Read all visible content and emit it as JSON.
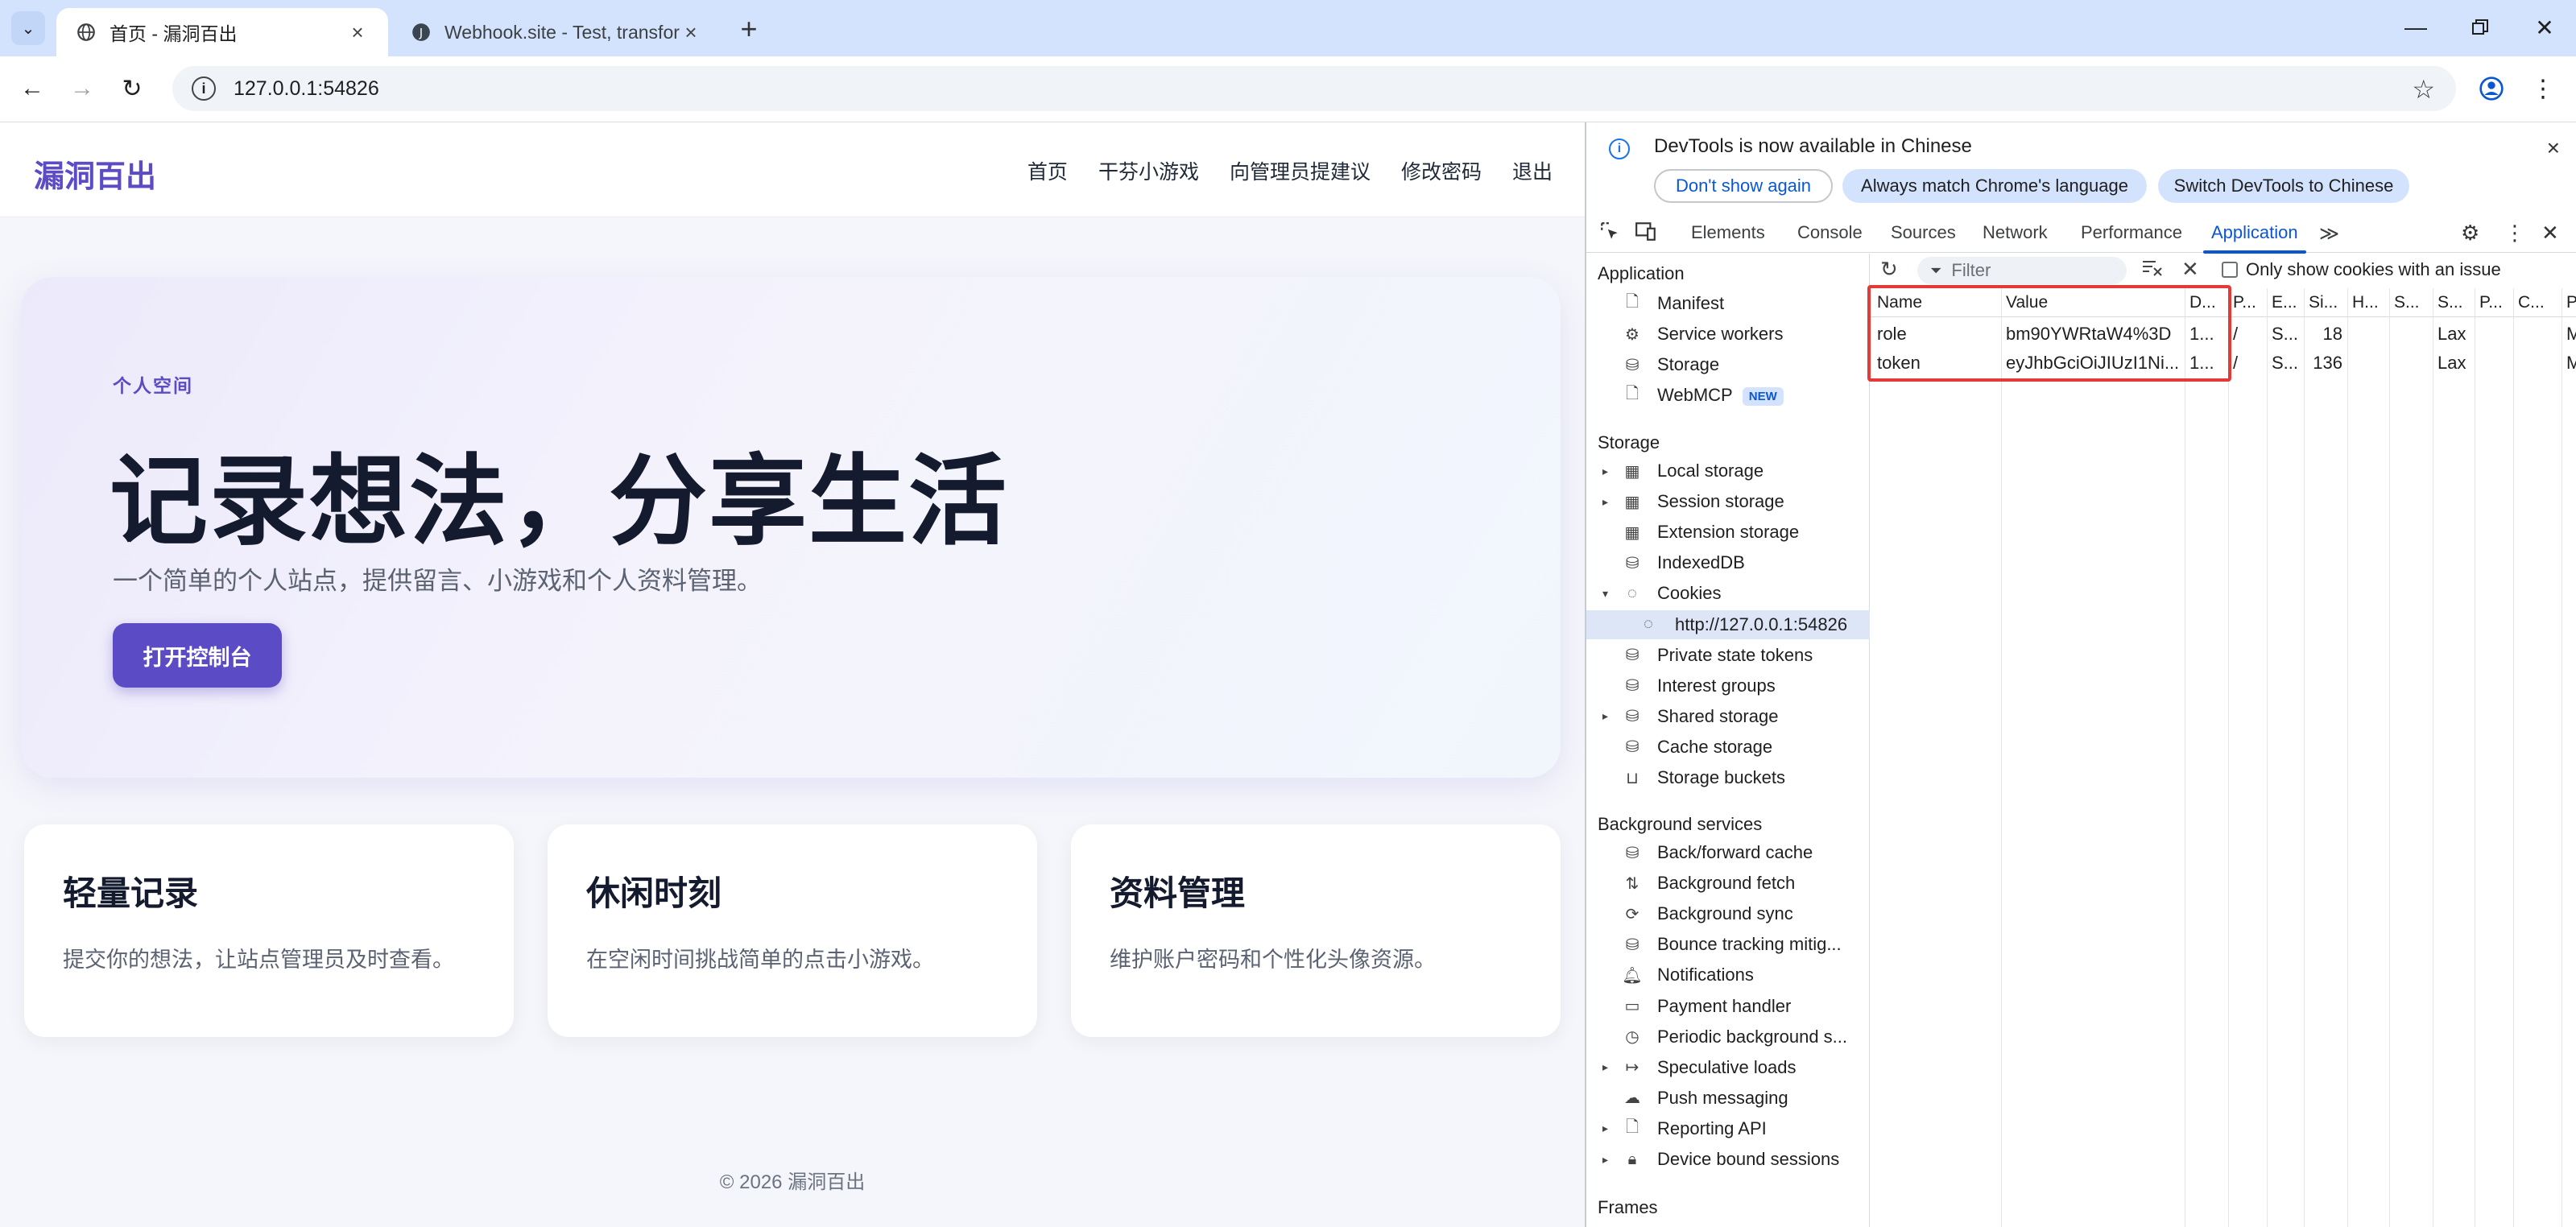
{
  "browser": {
    "tabs": [
      {
        "title": "首页 - 漏洞百出",
        "active": true
      },
      {
        "title": "Webhook.site - Test, transfor",
        "active": false
      }
    ],
    "url": "127.0.0.1:54826"
  },
  "site": {
    "logo": "漏洞百出",
    "nav": [
      "首页",
      "干芬小游戏",
      "向管理员提建议",
      "修改密码",
      "退出"
    ],
    "hero": {
      "eyebrow": "个人空间",
      "title": "记录想法，分享生活",
      "subtitle": "一个简单的个人站点，提供留言、小游戏和个人资料管理。",
      "cta": "打开控制台"
    },
    "cards": [
      {
        "title": "轻量记录",
        "desc": "提交你的想法，让站点管理员及时查看。"
      },
      {
        "title": "休闲时刻",
        "desc": "在空闲时间挑战简单的点击小游戏。"
      },
      {
        "title": "资料管理",
        "desc": "维护账户密码和个性化头像资源。"
      }
    ],
    "footer": "© 2026 漏洞百出"
  },
  "devtools": {
    "infobar": {
      "message": "DevTools is now available in Chinese",
      "buttons": [
        "Don't show again",
        "Always match Chrome's language",
        "Switch DevTools to Chinese"
      ]
    },
    "tabs": [
      "Elements",
      "Console",
      "Sources",
      "Network",
      "Performance",
      "Application"
    ],
    "active_tab": "Application",
    "filter_placeholder": "Filter",
    "only_issue_label": "Only show cookies with an issue",
    "sections": {
      "application": "Application",
      "storage": "Storage",
      "background": "Background services",
      "frames": "Frames"
    },
    "application_items": [
      {
        "label": "Manifest",
        "icon": "file-icon"
      },
      {
        "label": "Service workers",
        "icon": "gears-icon"
      },
      {
        "label": "Storage",
        "icon": "database-icon"
      },
      {
        "label": "WebMCP",
        "icon": "file-icon",
        "badge": "NEW"
      }
    ],
    "storage_items": [
      {
        "label": "Local storage",
        "icon": "table-icon",
        "arrow": "▸"
      },
      {
        "label": "Session storage",
        "icon": "table-icon",
        "arrow": "▸"
      },
      {
        "label": "Extension storage",
        "icon": "table-icon",
        "arrow": ""
      },
      {
        "label": "IndexedDB",
        "icon": "database-icon",
        "arrow": ""
      },
      {
        "label": "Cookies",
        "icon": "cookie-icon",
        "arrow": "▾"
      },
      {
        "label": "http://127.0.0.1:54826",
        "icon": "cookie-icon",
        "arrow": "",
        "child": true,
        "selected": true
      },
      {
        "label": "Private state tokens",
        "icon": "database-icon",
        "arrow": ""
      },
      {
        "label": "Interest groups",
        "icon": "database-icon",
        "arrow": ""
      },
      {
        "label": "Shared storage",
        "icon": "database-icon",
        "arrow": "▸"
      },
      {
        "label": "Cache storage",
        "icon": "database-icon",
        "arrow": ""
      },
      {
        "label": "Storage buckets",
        "icon": "bucket-icon",
        "arrow": ""
      }
    ],
    "background_items": [
      {
        "label": "Back/forward cache",
        "icon": "database-icon",
        "arrow": ""
      },
      {
        "label": "Background fetch",
        "icon": "updown-icon",
        "arrow": ""
      },
      {
        "label": "Background sync",
        "icon": "sync-icon",
        "arrow": ""
      },
      {
        "label": "Bounce tracking mitig...",
        "icon": "database-icon",
        "arrow": ""
      },
      {
        "label": "Notifications",
        "icon": "bell-icon",
        "arrow": ""
      },
      {
        "label": "Payment handler",
        "icon": "card-icon",
        "arrow": ""
      },
      {
        "label": "Periodic background s...",
        "icon": "clock-icon",
        "arrow": ""
      },
      {
        "label": "Speculative loads",
        "icon": "arrow-right-icon",
        "arrow": "▸"
      },
      {
        "label": "Push messaging",
        "icon": "cloud-icon",
        "arrow": ""
      },
      {
        "label": "Reporting API",
        "icon": "file-icon",
        "arrow": "▸"
      },
      {
        "label": "Device bound sessions",
        "icon": "lock-icon",
        "arrow": "▸"
      }
    ],
    "cookie_columns": [
      "Name",
      "Value",
      "D...",
      "P...",
      "E...",
      "Si...",
      "H...",
      "S...",
      "S...",
      "P...",
      "C...",
      "P"
    ],
    "cookies": [
      {
        "cells": [
          "role",
          "bm90YWRtaW4%3D",
          "1...",
          "/",
          "S...",
          "18",
          "",
          "",
          "Lax",
          "",
          "",
          "M"
        ]
      },
      {
        "cells": [
          "token",
          "eyJhbGciOiJIUzI1Ni...",
          "1...",
          "/",
          "S...",
          "136",
          "",
          "",
          "Lax",
          "",
          "",
          "M"
        ]
      }
    ],
    "highlight_color": "#e53935"
  }
}
